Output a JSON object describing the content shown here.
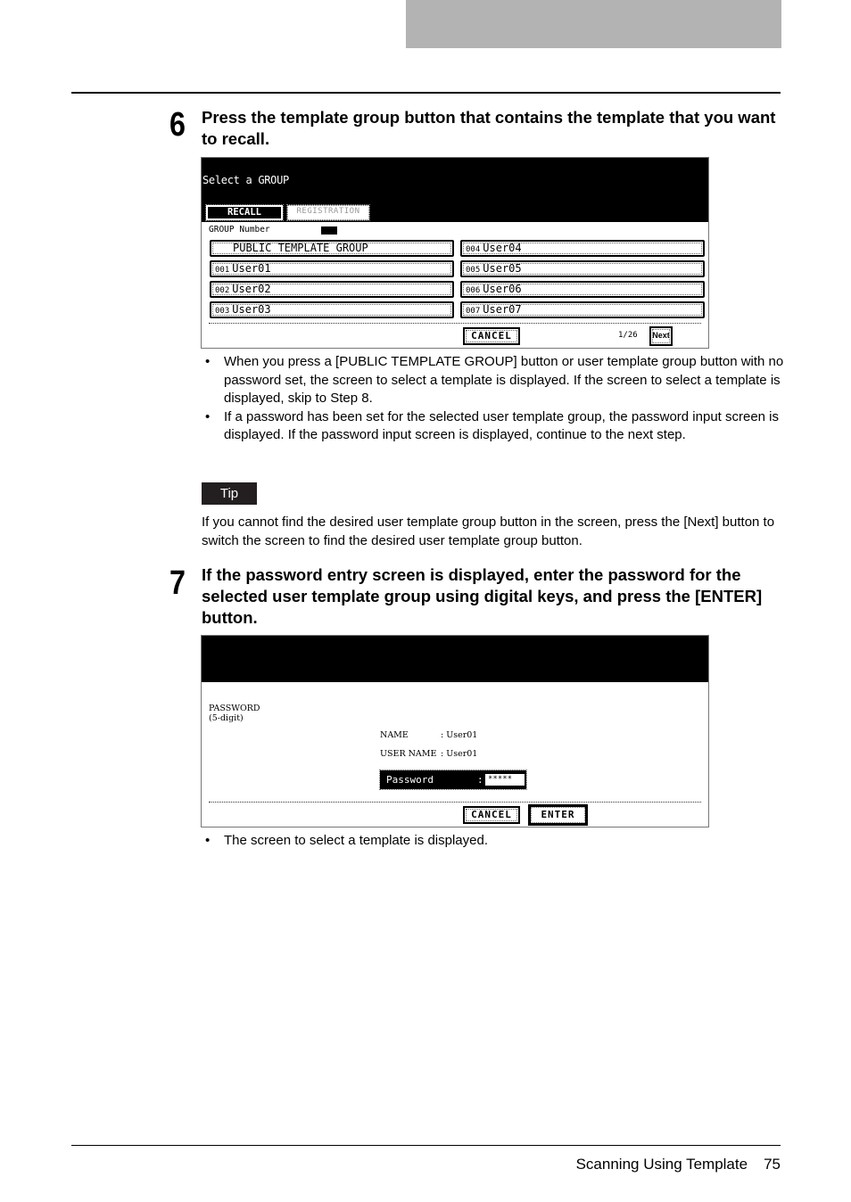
{
  "footer": {
    "section": "Scanning Using Template",
    "page": "75"
  },
  "step6": {
    "number": "6",
    "text": "Press the template group button that contains the template that you want to recall.",
    "screen": {
      "title": "Select a GROUP",
      "tabs": {
        "recall": "RECALL",
        "registration": "REGISTRATION"
      },
      "group_number_label": "GROUP Number",
      "groups_left": [
        {
          "num": "",
          "name": "PUBLIC TEMPLATE GROUP"
        },
        {
          "num": "001",
          "name": "User01"
        },
        {
          "num": "002",
          "name": "User02"
        },
        {
          "num": "003",
          "name": "User03"
        }
      ],
      "groups_right": [
        {
          "num": "004",
          "name": "User04"
        },
        {
          "num": "005",
          "name": "User05"
        },
        {
          "num": "006",
          "name": "User06"
        },
        {
          "num": "007",
          "name": "User07"
        }
      ],
      "cancel": "CANCEL",
      "page_indicator": "1/26",
      "next": "Next"
    },
    "notes": [
      "When you press a [PUBLIC TEMPLATE GROUP] button or user template group button with no password set, the screen to select a template is displayed.  If the screen to select a template is displayed, skip to Step 8.",
      "If a password has been set for the selected user template group, the password input screen is displayed.  If the password input screen is displayed, continue to the next step."
    ],
    "tip_label": "Tip",
    "tip_text": "If you cannot find the desired user template group button in the screen, press the [Next] button to switch the screen to find the desired user template group button."
  },
  "step7": {
    "number": "7",
    "text": "If the password entry screen is displayed, enter the password for the selected user template group using digital keys, and press the [ENTER] button.",
    "screen": {
      "password_label_1": "PASSWORD",
      "password_label_2": "(5-digit)",
      "name_key": "NAME",
      "name_value": ": User01",
      "username_key": "USER NAME",
      "username_value": ": User01",
      "password_field_label": "Password",
      "password_colon": ":",
      "password_value": "*****",
      "cancel": "CANCEL",
      "enter": "ENTER"
    },
    "notes": [
      "The screen to select a template is displayed."
    ]
  }
}
